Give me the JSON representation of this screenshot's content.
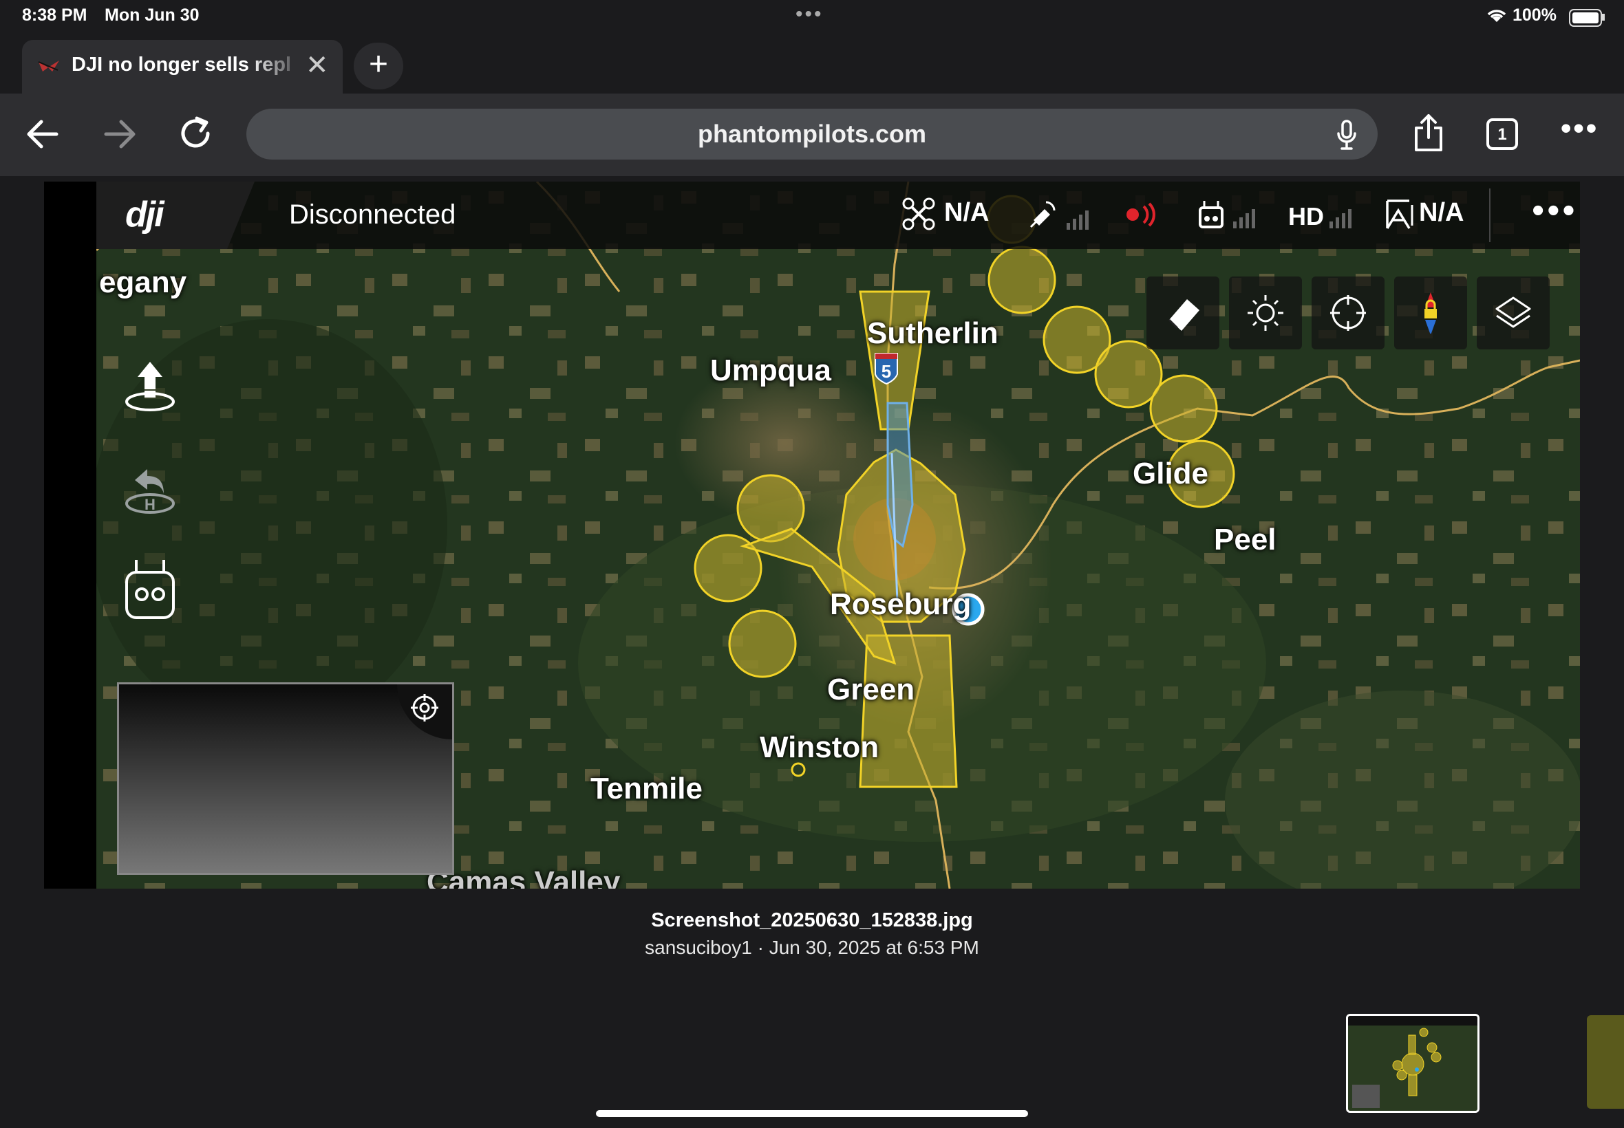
{
  "status_bar": {
    "time": "8:38 PM",
    "date": "Mon Jun 30",
    "battery": "100%",
    "wifi_icon": "wifi-icon",
    "battery_icon": "battery-icon"
  },
  "browser": {
    "tab_title": "DJI no longer sells replacement",
    "tab_close_icon": "close-icon",
    "new_tab_icon": "plus-icon",
    "url": "phantompilots.com",
    "tab_count": "1",
    "mic_icon": "microphone-icon",
    "share_icon": "share-icon",
    "more_icon": "ellipsis-icon"
  },
  "dji_app": {
    "status": "Disconnected",
    "drone_status": "N/A",
    "video_quality": "HD",
    "altitude_status": "N/A",
    "left_icons": [
      "takeoff-icon",
      "return-home-icon",
      "remote-controller-icon"
    ],
    "map_tools": [
      "eraser-icon",
      "brightness-icon",
      "locate-icon",
      "compass-lock-icon",
      "layers-icon"
    ],
    "places": {
      "egany": "egany",
      "sutherlin": "Sutherlin",
      "umpqua": "Umpqua",
      "glide": "Glide",
      "peel": "Peel",
      "roseburg": "Roseburg",
      "green": "Green",
      "winston": "Winston",
      "tenmile": "Tenmile",
      "camas": "Camas Valley",
      "highway": "5"
    }
  },
  "attachment": {
    "filename": "Screenshot_20250630_152838.jpg",
    "meta": "sansuciboy1 · Jun 30, 2025 at 6:53 PM"
  },
  "colors": {
    "nfz_fill": "#c9b32c",
    "nfz_stroke": "#f2d327",
    "airport": "#4a90c8",
    "user_dot": "#2aa8ef",
    "toolbar": "#2e2e31"
  }
}
